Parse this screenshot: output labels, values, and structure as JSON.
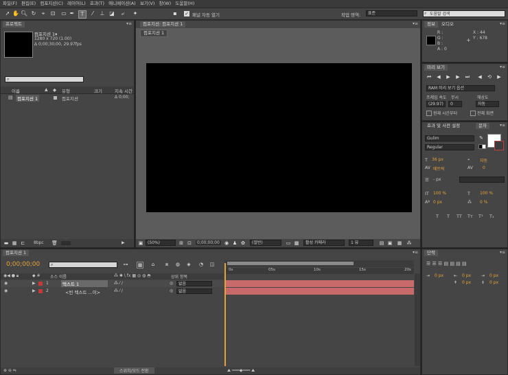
{
  "menu": [
    "파일(F)",
    "편집(E)",
    "컴포지션(C)",
    "레이어(L)",
    "효과(T)",
    "애니메이션(A)",
    "보기(V)",
    "창(W)",
    "도움말(H)"
  ],
  "toolbar": {
    "auto_open_label": "패널 자동 열기",
    "workspace_label": "작업 영역:",
    "workspace_value": "표준",
    "help_search_placeholder": "도움말 검색"
  },
  "project": {
    "tab": "프로젝트",
    "comp_name": "컴포지션 1▾",
    "comp_size": "1280 x 720 (1.00)",
    "comp_duration": "Δ 0;00;30;00, 29.97fps",
    "columns": [
      "이름",
      "유형",
      "크기",
      "지속 시간"
    ],
    "item_name": "컴포지션 1",
    "item_type": "컴포지션",
    "item_duration": "Δ 0;00;",
    "bpc": "8bpc"
  },
  "composition": {
    "tab": "컴포지션: 컴포지션 1",
    "subtab": "컴포지션 1",
    "zoom": "(50%)",
    "timecode": "0;00;00;00",
    "resolution": "(절반)",
    "camera": "활성 카메라",
    "views": "1 뷰"
  },
  "info": {
    "tab": "정보",
    "tab2": "오디오",
    "r": "R :",
    "g": "G :",
    "b": "B :",
    "a": "A : 0",
    "x": "X : 44",
    "y": "Y : 678"
  },
  "preview": {
    "tab": "미리 보기",
    "ram_options": "RAM 미리 보기 옵션",
    "frame_rate_label": "프레임 속도",
    "skip_label": "무시",
    "resolution_label": "해상도",
    "frame_rate": "(29.97)",
    "skip": "0",
    "resolution": "자동",
    "from_current": "현재 시간부터",
    "full_screen": "전체 화면"
  },
  "character": {
    "tab1": "효과 및 사전 설정",
    "tab2": "문자",
    "font": "Gulim",
    "style": "Regular",
    "font_size": "36 px",
    "leading": "자동",
    "kerning": "메트릭",
    "tracking": "0",
    "stroke": "- px",
    "v_scale": "100 %",
    "h_scale": "100 %",
    "baseline": "0 px",
    "tsume": "0 %"
  },
  "paragraph": {
    "tab": "단락",
    "indent1": "0 px",
    "indent2": "0 px",
    "indent3": "0 px",
    "space1": "0 px",
    "space2": "0 px"
  },
  "timeline": {
    "tab": "컴포지션 1",
    "timecode": "0;00;00;00",
    "col_source": "소스 이름",
    "col_parent": "상위 항목",
    "ruler": [
      "0s",
      "05s",
      "10s",
      "15s",
      "20s"
    ],
    "layers": [
      {
        "num": "1",
        "name": "텍스트 1",
        "parent": "없음"
      },
      {
        "num": "2",
        "name": "<빈 텍스트 ...이>",
        "parent": "없음"
      }
    ],
    "toggle_label": "스위치/모드 전환"
  },
  "colors": {
    "accent": "#e3a33a",
    "layer_bar": "#c96a6a",
    "layer_label": "#c23a3a"
  }
}
